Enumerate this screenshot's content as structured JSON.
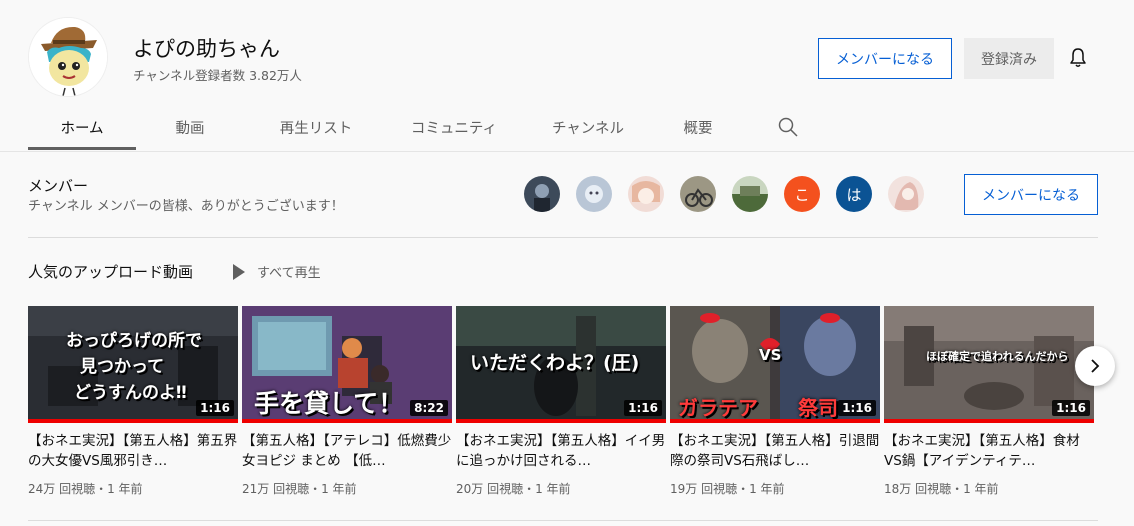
{
  "channel": {
    "name": "よぴの助ちゃん",
    "subscribers": "チャンネル登録者数 3.82万人",
    "member_button": "メンバーになる",
    "subscribed_button": "登録済み"
  },
  "tabs": [
    {
      "label": "ホーム",
      "active": true
    },
    {
      "label": "動画"
    },
    {
      "label": "再生リスト"
    },
    {
      "label": "コミュニティ"
    },
    {
      "label": "チャンネル"
    },
    {
      "label": "概要"
    }
  ],
  "members": {
    "title": "メンバー",
    "description": "チャンネル メンバーの皆様、ありがとうございます！",
    "button": "メンバーになる",
    "avatars": [
      {
        "type": "image",
        "color": "#3d4a5a"
      },
      {
        "type": "image",
        "color": "#b9c6d6"
      },
      {
        "type": "image",
        "color": "#e9cfc8"
      },
      {
        "type": "image",
        "color": "#7d7a6a"
      },
      {
        "type": "image",
        "color": "#4d6a3a"
      },
      {
        "type": "letter",
        "letter": "こ",
        "color": "#f4511e"
      },
      {
        "type": "letter",
        "letter": "は",
        "color": "#0b5394"
      },
      {
        "type": "image",
        "color": "#e8d0cc"
      }
    ]
  },
  "shelf": {
    "title": "人気のアップロード動画",
    "play_all": "すべて再生"
  },
  "videos": [
    {
      "thumb_text": [
        "おっぴろげの所で",
        "見つかって",
        "どうすんのよ‼"
      ],
      "duration": "1:16",
      "title": "【おネエ実況】【第五人格】第五界の大女優VS風邪引き…",
      "meta": "24万 回視聴・1 年前"
    },
    {
      "thumb_text": [
        "手を貸して！"
      ],
      "duration": "8:22",
      "title": "【第五人格】【アテレコ】低燃費少女ヨピジ まとめ 【低…",
      "meta": "21万 回視聴・1 年前"
    },
    {
      "thumb_text": [
        "いただくわよ？(圧)"
      ],
      "duration": "1:16",
      "title": "【おネエ実況】【第五人格】イイ男に追っかけ回される…",
      "meta": "20万 回視聴・1 年前"
    },
    {
      "thumb_text": [
        "VS",
        "ガラテア",
        "祭司"
      ],
      "duration": "1:16",
      "title": "【おネエ実況】【第五人格】引退間際の祭司VS石飛ばし…",
      "meta": "19万 回視聴・1 年前"
    },
    {
      "thumb_text": [
        "ほぼ確定で追われるんだから"
      ],
      "duration": "1:16",
      "title": "【おネエ実況】【第五人格】食材VS鍋【アイデンティテ…",
      "meta": "18万 回視聴・1 年前"
    }
  ]
}
